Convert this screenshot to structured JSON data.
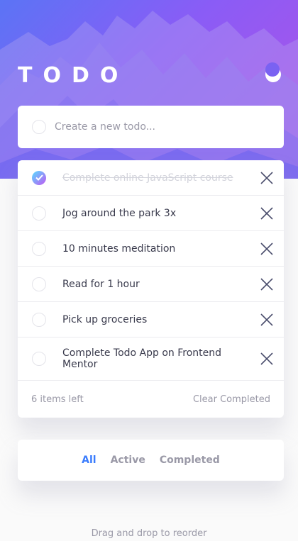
{
  "app": {
    "title": "TODO",
    "theme_icon": "moon-icon"
  },
  "create": {
    "placeholder": "Create a new todo..."
  },
  "todos": [
    {
      "text": "Complete online JavaScript course",
      "completed": true
    },
    {
      "text": "Jog around the park 3x",
      "completed": false
    },
    {
      "text": "10 minutes meditation",
      "completed": false
    },
    {
      "text": "Read for 1 hour",
      "completed": false
    },
    {
      "text": "Pick up groceries",
      "completed": false
    },
    {
      "text": "Complete Todo App on Frontend Mentor",
      "completed": false
    }
  ],
  "footer": {
    "items_left": "6 items left",
    "clear_label": "Clear Completed"
  },
  "filters": {
    "all": "All",
    "active": "Active",
    "completed": "Completed",
    "selected": "All"
  },
  "hint": "Drag and drop to reorder",
  "colors": {
    "accent": "#3a7cfd",
    "check_gradient_start": "#57ddff",
    "check_gradient_end": "#c058f3",
    "header_gradient_start": "#5b74f5",
    "header_gradient_end": "#b052e6",
    "muted_text": "#9a99a7",
    "primary_text": "#393a4c",
    "completed_text": "#d2d3db"
  },
  "icons": {
    "check": "check-icon",
    "delete": "close-icon"
  }
}
